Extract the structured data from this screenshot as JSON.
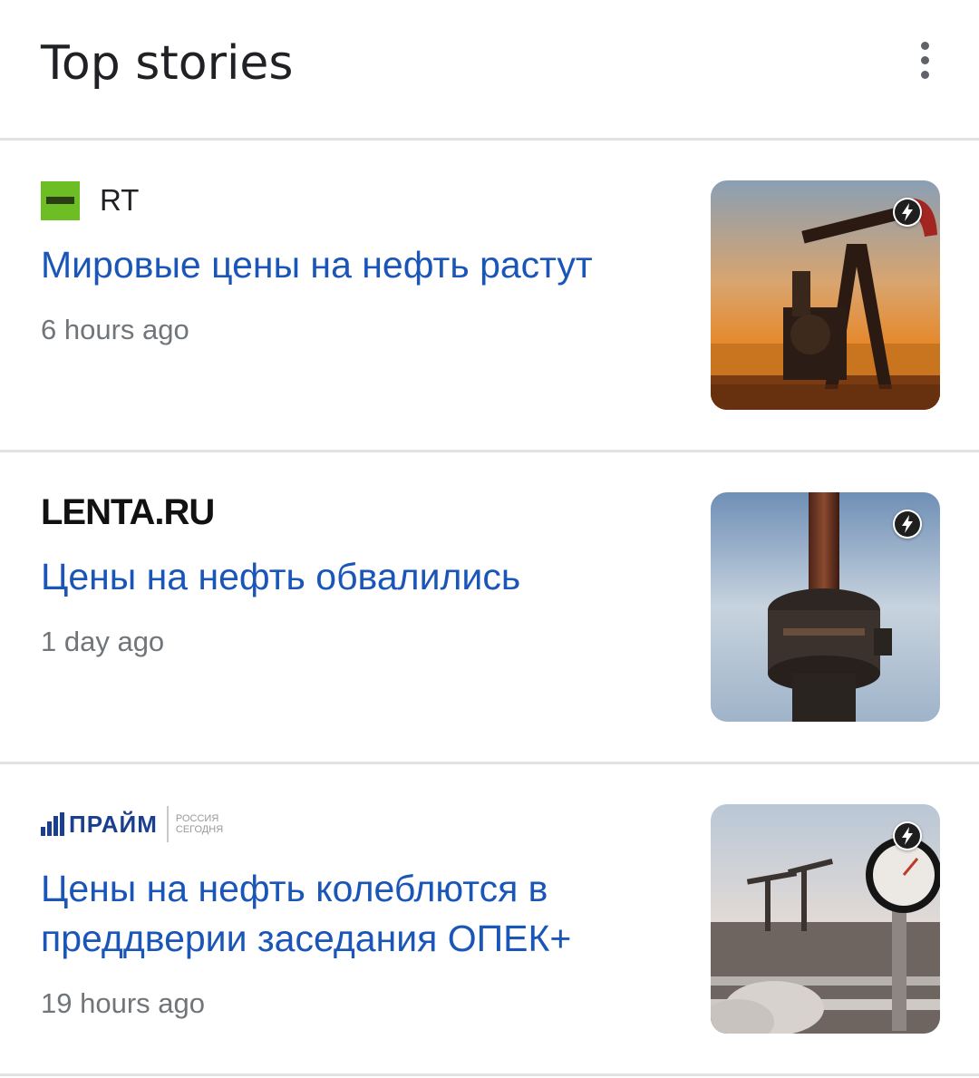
{
  "header": {
    "title": "Top stories",
    "menu_icon": "more-vert-icon"
  },
  "stories": [
    {
      "source": "RT",
      "source_logo": "rt-logo",
      "headline": "Мировые цены на нефть растут",
      "time": "6 hours ago",
      "thumbnail": "oil-pumpjack-image",
      "amp_icon": "amp-lightning-icon"
    },
    {
      "source": "LENTA.RU",
      "source_logo": "lenta-ru-logo",
      "headline": "Цены на нефть обвалились",
      "time": "1 day ago",
      "thumbnail": "oil-pipe-valve-image",
      "amp_icon": "amp-lightning-icon"
    },
    {
      "source": "ПРАЙМ",
      "source_sub": "РОССИЯ СЕГОДНЯ",
      "source_logo": "prime-logo",
      "headline": "Цены на нефть колеблются в преддверии заседания ОПЕК+",
      "time": "19 hours ago",
      "thumbnail": "oil-field-pressure-gauge-image",
      "amp_icon": "amp-lightning-icon"
    }
  ],
  "colors": {
    "headline": "#1a55b8",
    "time": "#70757a",
    "divider": "#e3e3e3",
    "title": "#202124"
  }
}
